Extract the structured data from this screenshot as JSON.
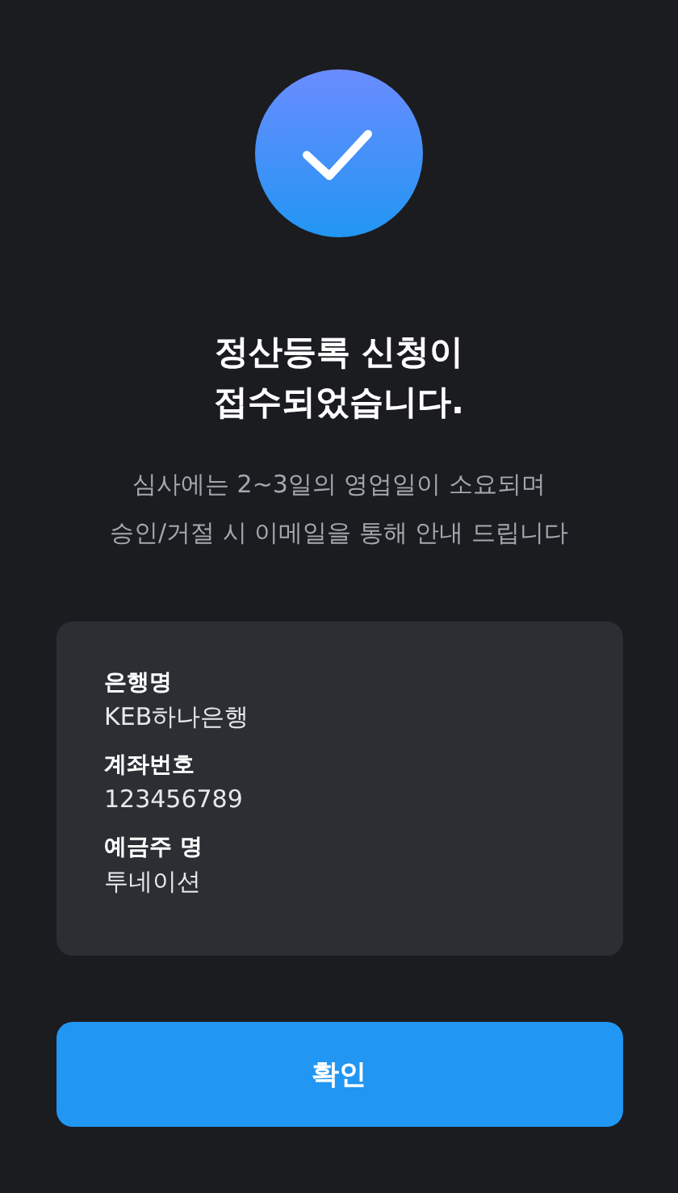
{
  "title": [
    "정산등록 신청이",
    "접수되었습니다."
  ],
  "description": [
    "심사에는 2~3일의 영업일이 소요되며",
    "승인/거절 시 이메일을 통해 안내 드립니다"
  ],
  "details": [
    {
      "label": "은행명",
      "value": "KEB하나은행"
    },
    {
      "label": "계좌번호",
      "value": "123456789"
    },
    {
      "label": "예금주 명",
      "value": "투네이션"
    }
  ],
  "confirm_button": "확인"
}
